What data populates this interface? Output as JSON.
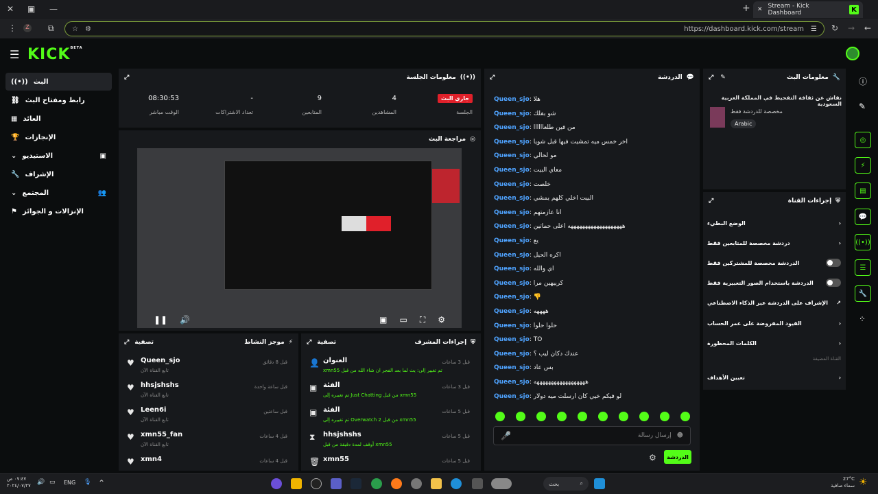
{
  "browser": {
    "tab_title": "Stream - Kick Dashboard",
    "tab_favicon": "K",
    "url": "https://dashboard.kick.com/stream",
    "new_tab": "+",
    "close_tab": "✕"
  },
  "app": {
    "logo": "KICK",
    "logo_badge": "BETA"
  },
  "sidebar": {
    "items": [
      {
        "label": "البث"
      },
      {
        "label": "رابط ومفتاح البث"
      },
      {
        "label": "العائد"
      },
      {
        "label": "الإنجازات"
      },
      {
        "label": "الاستيديو"
      },
      {
        "label": "الإشراف"
      },
      {
        "label": "المجتمع"
      },
      {
        "label": "الإنزالات و الجوائز"
      }
    ]
  },
  "session": {
    "title": "معلومات الجلسة",
    "live_badge": "جاري البث",
    "session_label": "الجلسة",
    "viewers_value": "4",
    "viewers_label": "المشاهدين",
    "followers_value": "9",
    "followers_label": "المتابعين",
    "subs_value": "-",
    "subs_label": "تعداد الاشتراكات",
    "time_value": "08:30:53",
    "time_label": "الوقت مباشر"
  },
  "preview": {
    "title": "مراجعة البث"
  },
  "activity": {
    "title": "موجز النشاط",
    "filter": "تصفية",
    "items": [
      {
        "name": "Queen_sjo",
        "sub": "تابع القناة الآن",
        "time": "قبل 8 دقائق"
      },
      {
        "name": "hhsjshshs",
        "sub": "تابع القناة الآن",
        "time": "قبل ساعة واحدة"
      },
      {
        "name": "Leen6i",
        "sub": "تابع القناة الآن",
        "time": "قبل ساعتين"
      },
      {
        "name": "xmn55_fan",
        "sub": "تابع القناة الآن",
        "time": "قبل 4 ساعات"
      },
      {
        "name": "xmn4",
        "sub": "",
        "time": "قبل 4 ساعات"
      }
    ]
  },
  "modactions": {
    "title": "إجراءات المشرف",
    "filter": "تصفية",
    "items": [
      {
        "title": "العنوان",
        "detail": "xmn55 تم تغيير إلى: يث لما بعد الفجر ان شاء الله من قبل",
        "time": "قبل 3 ساعات"
      },
      {
        "title": "الفئة",
        "detail": "تم تغييره إلى Just Chatting من قبل xmn55",
        "time": "قبل 3 ساعات"
      },
      {
        "title": "الفئة",
        "detail": "تم تغييره إلى Overwatch 2 من قبل xmn55",
        "time": "قبل 5 ساعات"
      },
      {
        "title": "hhsjshshs",
        "detail": "أوقف لمدة دقيقة من قبل xmn55",
        "time": "قبل 5 ساعات"
      },
      {
        "title": "xmn55",
        "detail": "",
        "time": "قبل 5 ساعات"
      }
    ]
  },
  "chat": {
    "title": "الدردشة",
    "messages": [
      {
        "user": "Queen_sjo",
        "text": "هلا"
      },
      {
        "user": "Queen_sjo",
        "text": "شو بقلك"
      },
      {
        "user": "Queen_sjo",
        "text": "من فين طلعاااااا"
      },
      {
        "user": "Queen_sjo",
        "text": "اخر خمس ميه تمشيت فيها قبل شويا"
      },
      {
        "user": "Queen_sjo",
        "text": "مو لحالي"
      },
      {
        "user": "Queen_sjo",
        "text": "معاي البيت"
      },
      {
        "user": "Queen_sjo",
        "text": "خلصت"
      },
      {
        "user": "Queen_sjo",
        "text": "البيت اخلي كلهم يمشي"
      },
      {
        "user": "Queen_sjo",
        "text": "انا عازمتهم"
      },
      {
        "user": "Queen_sjo",
        "text": "هههههههههههههههههههه اعلى حماتين"
      },
      {
        "user": "Queen_sjo",
        "text": "يع"
      },
      {
        "user": "Queen_sjo",
        "text": "اكره الحيل"
      },
      {
        "user": "Queen_sjo",
        "text": "اي والله"
      },
      {
        "user": "Queen_sjo",
        "text": "كرييهين مرا"
      },
      {
        "user": "Queen_sjo",
        "text": "👎"
      },
      {
        "user": "Queen_sjo",
        "text": "ههههه"
      },
      {
        "user": "Queen_sjo",
        "text": "حلوا حلوا"
      },
      {
        "user": "Queen_sjo",
        "text": "TO"
      },
      {
        "user": "Queen_sjo",
        "text": "عندك دكان ليب ؟"
      },
      {
        "user": "Queen_sjo",
        "text": "بس عاد"
      },
      {
        "user": "Queen_sjo",
        "text": "ههههههههههههههههههه"
      },
      {
        "user": "Queen_sjo",
        "text": "لو فيكم خيي كان ارسلت ميه دولار"
      }
    ],
    "input_placeholder": "إرسال رسالة",
    "send_button": "الدردشة"
  },
  "streaminfo": {
    "title": "معلومات البث",
    "stream_title": "نقاش عن ثقافة التفحيط في المملكة العربية السعودية",
    "category_note": "مخصصة للدردشة فقط",
    "language": "Arabic"
  },
  "channel": {
    "title": "إجراءات القناة",
    "slow_mode": "الوضع البطيء",
    "followers_only": "دردشة مخصصة للمتابعين فقط",
    "subs_only": "الدردشة مخصصة للمشتركين فقط",
    "emote_only": "الدردشة باستخدام الصور التعبيرية فقط",
    "ai_mod": "الإشراف على الدردشة عبر الذكاء الاصطناعي",
    "age_limit": "القيود المفروضة على عمر الحساب",
    "banned_words": "الكلمات المحظورة",
    "pinned_label": "القناة المضيفة",
    "goals": "تعيين الأهداف"
  },
  "taskbar": {
    "time": "٠٧:٤٧ ص",
    "date": "٢٠٢٤/٠٧/٢٧",
    "lang": "ENG",
    "temp": "27°C",
    "weather": "سماء صافية",
    "search": "بحث"
  },
  "colors": {
    "brand": "#53fc18",
    "live": "#e0202a",
    "username": "#4fa3ff"
  }
}
